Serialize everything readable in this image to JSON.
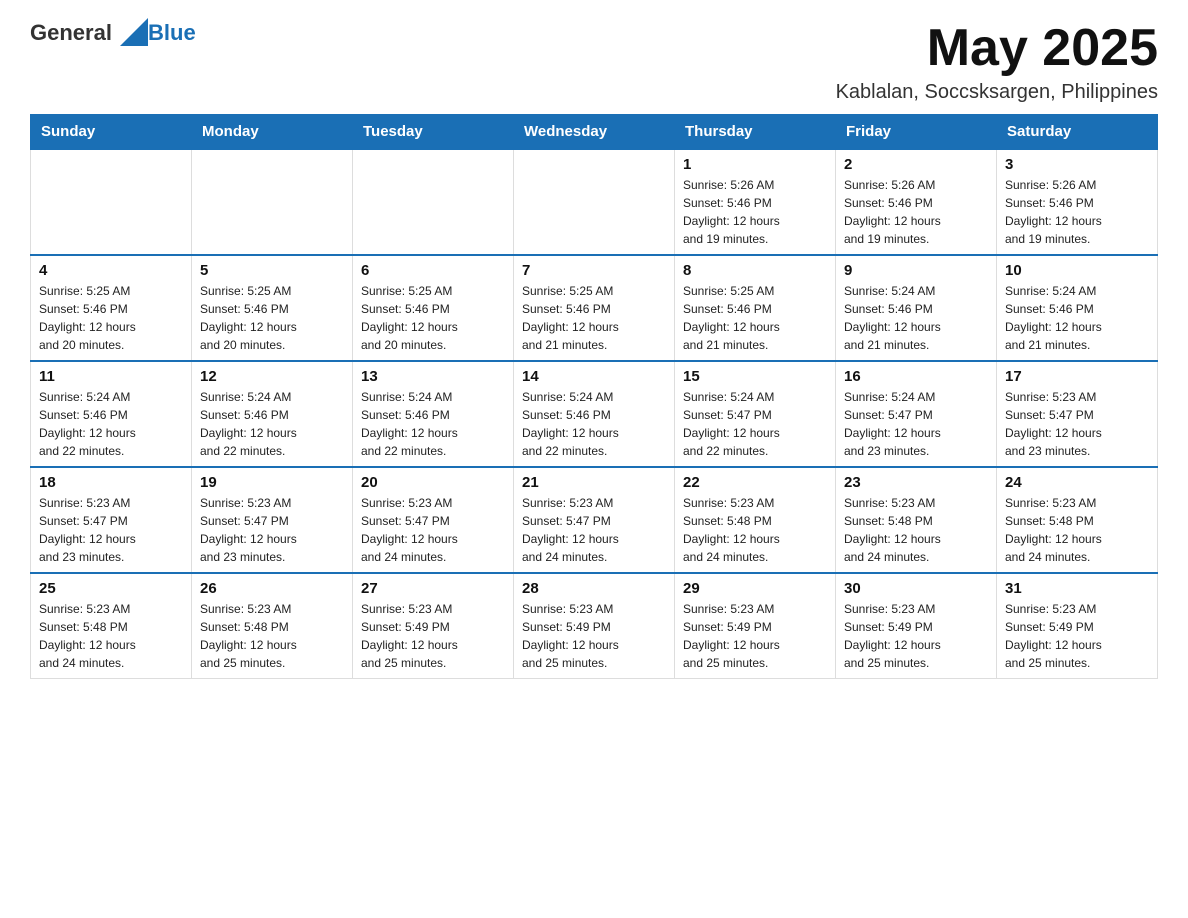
{
  "header": {
    "logo_text_general": "General",
    "logo_text_blue": "Blue",
    "month_title": "May 2025",
    "location": "Kablalan, Soccsksargen, Philippines"
  },
  "days_of_week": [
    "Sunday",
    "Monday",
    "Tuesday",
    "Wednesday",
    "Thursday",
    "Friday",
    "Saturday"
  ],
  "weeks": [
    [
      {
        "day": "",
        "info": ""
      },
      {
        "day": "",
        "info": ""
      },
      {
        "day": "",
        "info": ""
      },
      {
        "day": "",
        "info": ""
      },
      {
        "day": "1",
        "info": "Sunrise: 5:26 AM\nSunset: 5:46 PM\nDaylight: 12 hours\nand 19 minutes."
      },
      {
        "day": "2",
        "info": "Sunrise: 5:26 AM\nSunset: 5:46 PM\nDaylight: 12 hours\nand 19 minutes."
      },
      {
        "day": "3",
        "info": "Sunrise: 5:26 AM\nSunset: 5:46 PM\nDaylight: 12 hours\nand 19 minutes."
      }
    ],
    [
      {
        "day": "4",
        "info": "Sunrise: 5:25 AM\nSunset: 5:46 PM\nDaylight: 12 hours\nand 20 minutes."
      },
      {
        "day": "5",
        "info": "Sunrise: 5:25 AM\nSunset: 5:46 PM\nDaylight: 12 hours\nand 20 minutes."
      },
      {
        "day": "6",
        "info": "Sunrise: 5:25 AM\nSunset: 5:46 PM\nDaylight: 12 hours\nand 20 minutes."
      },
      {
        "day": "7",
        "info": "Sunrise: 5:25 AM\nSunset: 5:46 PM\nDaylight: 12 hours\nand 21 minutes."
      },
      {
        "day": "8",
        "info": "Sunrise: 5:25 AM\nSunset: 5:46 PM\nDaylight: 12 hours\nand 21 minutes."
      },
      {
        "day": "9",
        "info": "Sunrise: 5:24 AM\nSunset: 5:46 PM\nDaylight: 12 hours\nand 21 minutes."
      },
      {
        "day": "10",
        "info": "Sunrise: 5:24 AM\nSunset: 5:46 PM\nDaylight: 12 hours\nand 21 minutes."
      }
    ],
    [
      {
        "day": "11",
        "info": "Sunrise: 5:24 AM\nSunset: 5:46 PM\nDaylight: 12 hours\nand 22 minutes."
      },
      {
        "day": "12",
        "info": "Sunrise: 5:24 AM\nSunset: 5:46 PM\nDaylight: 12 hours\nand 22 minutes."
      },
      {
        "day": "13",
        "info": "Sunrise: 5:24 AM\nSunset: 5:46 PM\nDaylight: 12 hours\nand 22 minutes."
      },
      {
        "day": "14",
        "info": "Sunrise: 5:24 AM\nSunset: 5:46 PM\nDaylight: 12 hours\nand 22 minutes."
      },
      {
        "day": "15",
        "info": "Sunrise: 5:24 AM\nSunset: 5:47 PM\nDaylight: 12 hours\nand 22 minutes."
      },
      {
        "day": "16",
        "info": "Sunrise: 5:24 AM\nSunset: 5:47 PM\nDaylight: 12 hours\nand 23 minutes."
      },
      {
        "day": "17",
        "info": "Sunrise: 5:23 AM\nSunset: 5:47 PM\nDaylight: 12 hours\nand 23 minutes."
      }
    ],
    [
      {
        "day": "18",
        "info": "Sunrise: 5:23 AM\nSunset: 5:47 PM\nDaylight: 12 hours\nand 23 minutes."
      },
      {
        "day": "19",
        "info": "Sunrise: 5:23 AM\nSunset: 5:47 PM\nDaylight: 12 hours\nand 23 minutes."
      },
      {
        "day": "20",
        "info": "Sunrise: 5:23 AM\nSunset: 5:47 PM\nDaylight: 12 hours\nand 24 minutes."
      },
      {
        "day": "21",
        "info": "Sunrise: 5:23 AM\nSunset: 5:47 PM\nDaylight: 12 hours\nand 24 minutes."
      },
      {
        "day": "22",
        "info": "Sunrise: 5:23 AM\nSunset: 5:48 PM\nDaylight: 12 hours\nand 24 minutes."
      },
      {
        "day": "23",
        "info": "Sunrise: 5:23 AM\nSunset: 5:48 PM\nDaylight: 12 hours\nand 24 minutes."
      },
      {
        "day": "24",
        "info": "Sunrise: 5:23 AM\nSunset: 5:48 PM\nDaylight: 12 hours\nand 24 minutes."
      }
    ],
    [
      {
        "day": "25",
        "info": "Sunrise: 5:23 AM\nSunset: 5:48 PM\nDaylight: 12 hours\nand 24 minutes."
      },
      {
        "day": "26",
        "info": "Sunrise: 5:23 AM\nSunset: 5:48 PM\nDaylight: 12 hours\nand 25 minutes."
      },
      {
        "day": "27",
        "info": "Sunrise: 5:23 AM\nSunset: 5:49 PM\nDaylight: 12 hours\nand 25 minutes."
      },
      {
        "day": "28",
        "info": "Sunrise: 5:23 AM\nSunset: 5:49 PM\nDaylight: 12 hours\nand 25 minutes."
      },
      {
        "day": "29",
        "info": "Sunrise: 5:23 AM\nSunset: 5:49 PM\nDaylight: 12 hours\nand 25 minutes."
      },
      {
        "day": "30",
        "info": "Sunrise: 5:23 AM\nSunset: 5:49 PM\nDaylight: 12 hours\nand 25 minutes."
      },
      {
        "day": "31",
        "info": "Sunrise: 5:23 AM\nSunset: 5:49 PM\nDaylight: 12 hours\nand 25 minutes."
      }
    ]
  ]
}
